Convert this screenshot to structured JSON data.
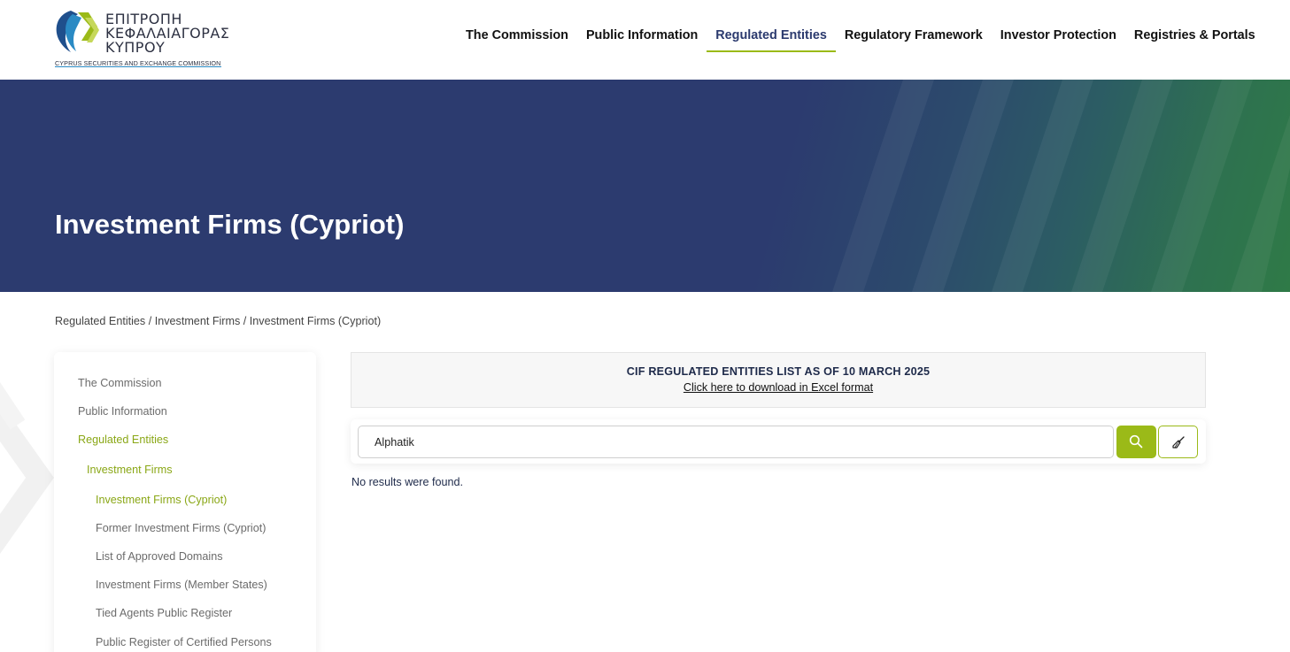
{
  "logo": {
    "line1": "ΕΠΙΤΡΟΠΗ",
    "line2": "ΚΕΦΑΛΑΙΑΓΟΡΑΣ",
    "line3": "ΚΥΠΡΟΥ",
    "subtitle": "CYPRUS SECURITIES AND EXCHANGE COMMISSION"
  },
  "nav": {
    "items": [
      {
        "label": "The Commission"
      },
      {
        "label": "Public Information"
      },
      {
        "label": "Regulated Entities",
        "active": true
      },
      {
        "label": "Regulatory Framework"
      },
      {
        "label": "Investor Protection"
      },
      {
        "label": "Registries & Portals"
      }
    ]
  },
  "hero": {
    "title": "Investment Firms (Cypriot)"
  },
  "breadcrumb": {
    "items": [
      "Regulated Entities",
      "Investment Firms",
      "Investment Firms (Cypriot)"
    ],
    "separator": " / "
  },
  "sidebar": {
    "items": [
      {
        "label": "The Commission"
      },
      {
        "label": "Public Information"
      },
      {
        "label": "Regulated Entities",
        "active": true
      },
      {
        "label": "Investment Firms",
        "active": true
      },
      {
        "label": "Investment Firms (Cypriot)",
        "active": true
      },
      {
        "label": "Former Investment Firms (Cypriot)"
      },
      {
        "label": "List of Approved Domains"
      },
      {
        "label": "Investment Firms (Member States)"
      },
      {
        "label": "Tied Agents Public Register"
      },
      {
        "label": "Public Register of Certified Persons"
      }
    ]
  },
  "banner": {
    "title": "CIF REGULATED ENTITIES LIST AS OF 10 MARCH 2025",
    "link": "Click here to download in Excel format"
  },
  "search": {
    "value": "Alphatik",
    "search_icon": "search-icon",
    "clear_icon": "broom-icon"
  },
  "results": {
    "message": "No results were found."
  },
  "colors": {
    "accent_green": "#9bba18",
    "hero_blue": "#2c3b6f",
    "hero_green": "#2f7a47",
    "sidebar_active": "#8aa716"
  }
}
